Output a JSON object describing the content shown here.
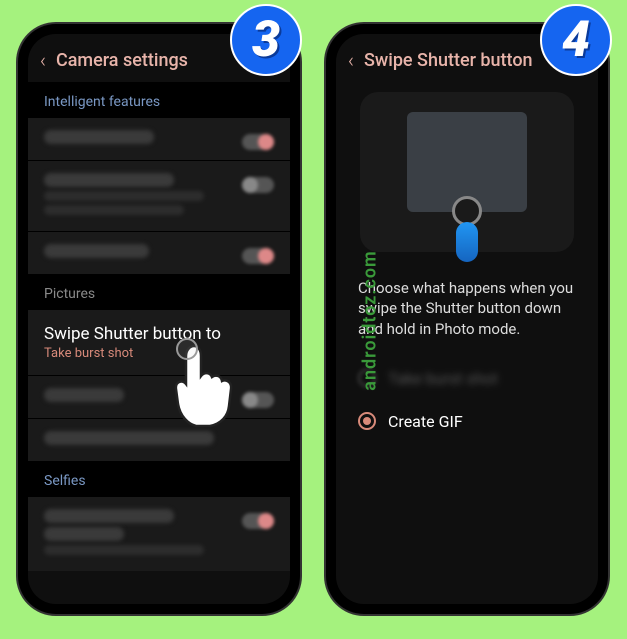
{
  "badges": {
    "step3": "3",
    "step4": "4"
  },
  "watermark": "androidtoz.com",
  "left": {
    "header_title": "Camera settings",
    "sections": {
      "intelligent": "Intelligent features",
      "pictures": "Pictures",
      "selfies": "Selfies"
    },
    "swipe": {
      "title": "Swipe Shutter button to",
      "subtitle": "Take burst shot"
    }
  },
  "right": {
    "header_title": "Swipe Shutter button",
    "description": "Choose what happens when you swipe the Shutter button down and hold in Photo mode.",
    "options": {
      "burst": "Take burst shot",
      "gif": "Create GIF"
    }
  }
}
